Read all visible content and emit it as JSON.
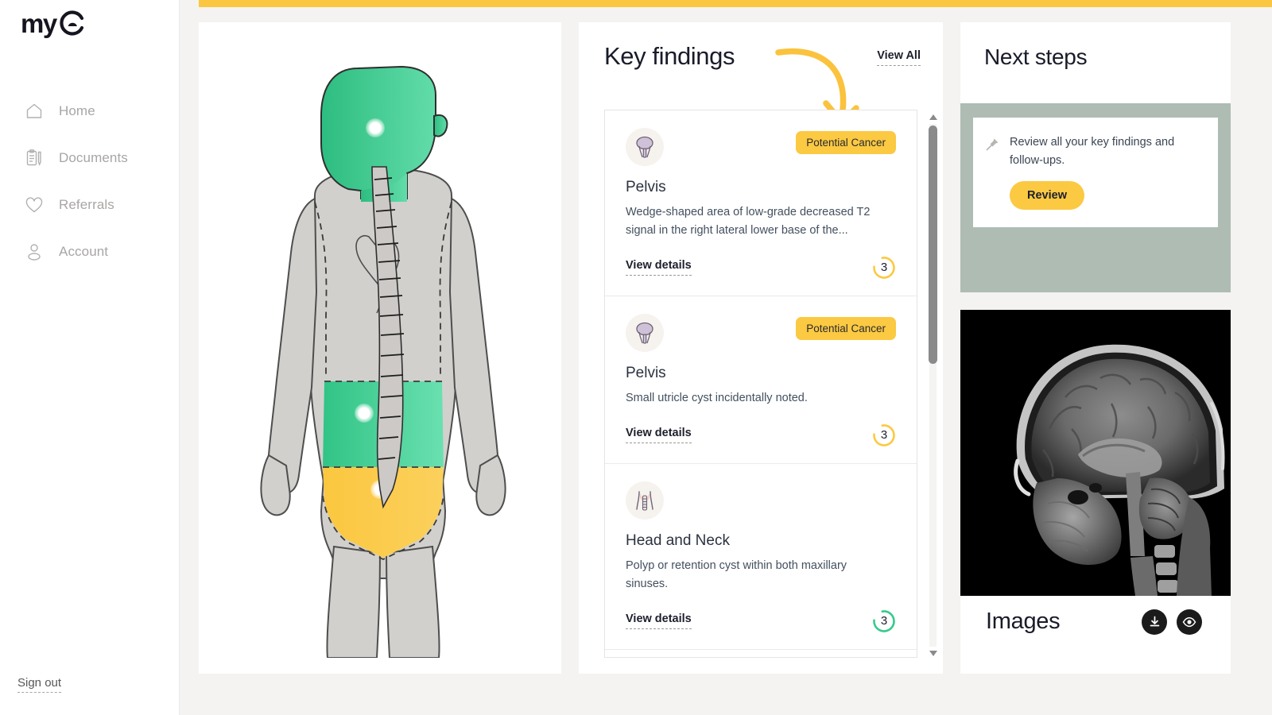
{
  "brand": {
    "logo_text": "my",
    "logo_mark": "arch-circle-logo"
  },
  "sidebar": {
    "items": [
      {
        "label": "Home",
        "icon": "home-icon"
      },
      {
        "label": "Documents",
        "icon": "documents-icon"
      },
      {
        "label": "Referrals",
        "icon": "heart-icon"
      },
      {
        "label": "Account",
        "icon": "user-icon"
      }
    ],
    "signout_label": "Sign out"
  },
  "body_map": {
    "regions": [
      {
        "name": "head-and-neck",
        "color": "#36ca8b",
        "marker": true
      },
      {
        "name": "abdomen",
        "color": "#4fd49b",
        "marker": true
      },
      {
        "name": "pelvis",
        "color": "#fbc942",
        "marker": true
      }
    ],
    "base_color": "#d2d0cd"
  },
  "findings": {
    "title": "Key findings",
    "view_all_label": "View All",
    "arrow": "curved-arrow-annotation",
    "cards": [
      {
        "icon": "pelvis-bladder-icon",
        "badge": "Potential Cancer",
        "title": "Pelvis",
        "description": "Wedge-shaped area of low-grade decreased T2 signal in the right lateral lower base of the...",
        "details_label": "View details",
        "count": "3",
        "ring_color": "#fbc942"
      },
      {
        "icon": "pelvis-bladder-icon",
        "badge": "Potential Cancer",
        "title": "Pelvis",
        "description": "Small utricle cyst incidentally noted.",
        "details_label": "View details",
        "count": "3",
        "ring_color": "#fbc942"
      },
      {
        "icon": "head-neck-spine-icon",
        "badge": "",
        "title": "Head and Neck",
        "description": "Polyp or retention cyst within both maxillary sinuses.",
        "details_label": "View details",
        "count": "3",
        "ring_color": "#36ca8b"
      }
    ]
  },
  "next_steps": {
    "title": "Next steps",
    "item_icon": "pin-icon",
    "item_text": "Review all your key findings and follow-ups.",
    "button_label": "Review"
  },
  "images": {
    "label": "Images",
    "scan_type": "sagittal-brain-mri",
    "actions": [
      {
        "name": "download-icon"
      },
      {
        "name": "eye-icon"
      }
    ]
  },
  "colors": {
    "accent_yellow": "#fbc942",
    "accent_green": "#36ca8b",
    "sage": "#aebcb4",
    "page_bg": "#f4f3f1"
  }
}
